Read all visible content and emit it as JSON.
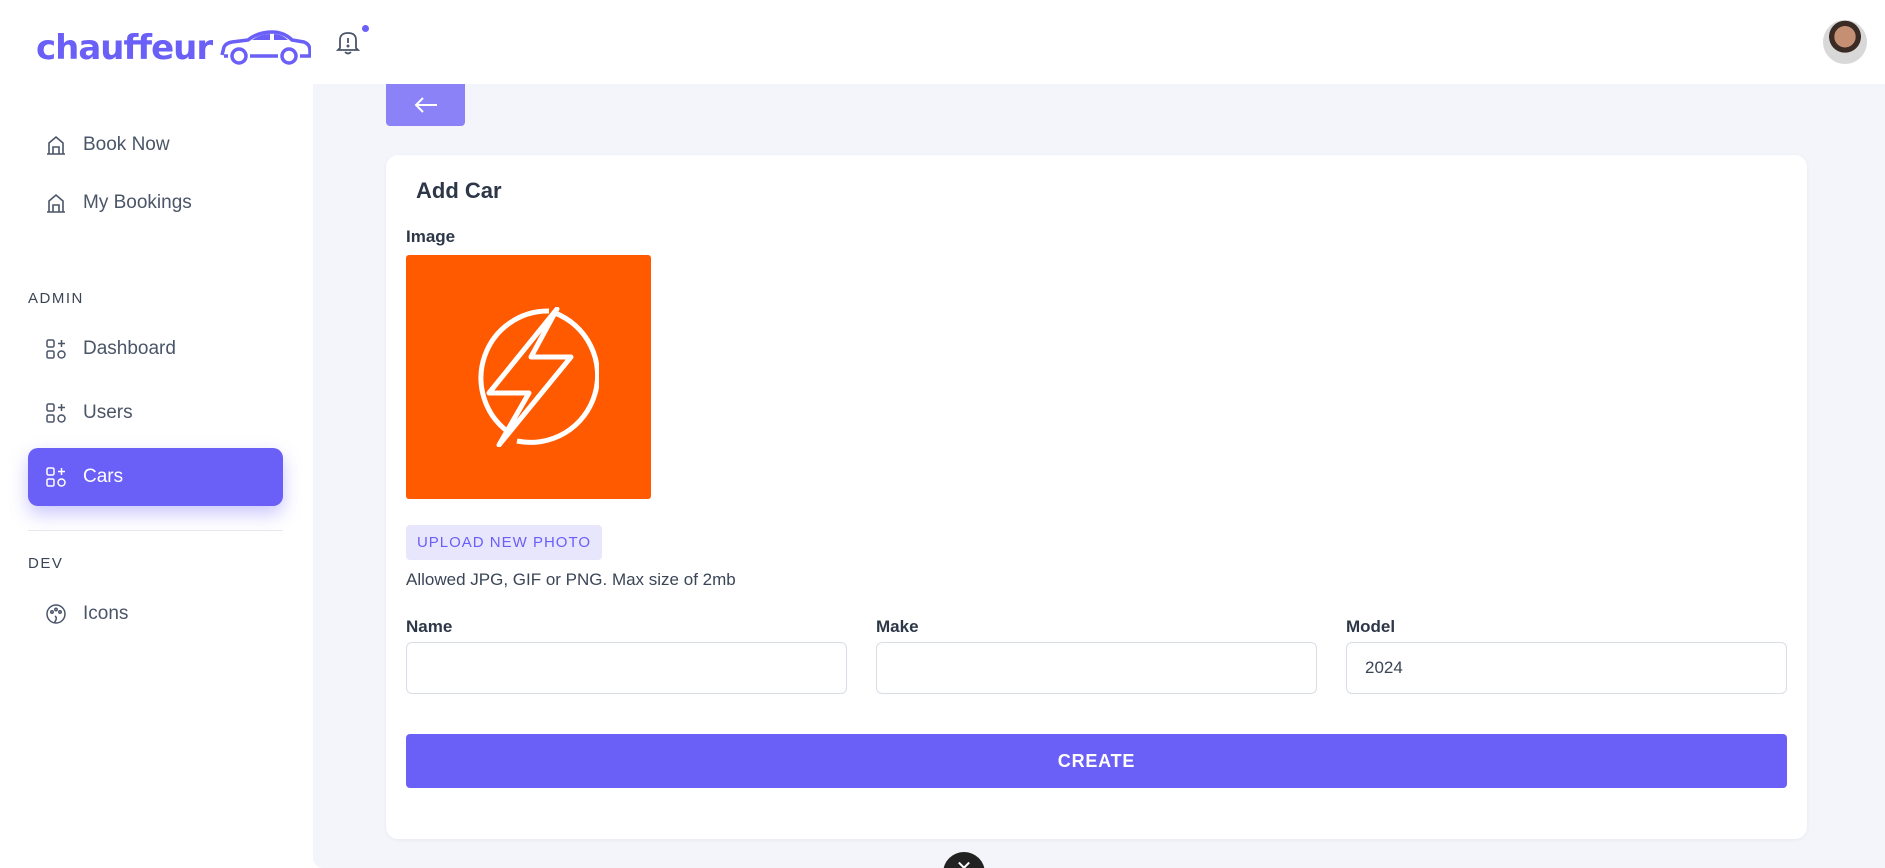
{
  "brand": {
    "name": "chauffeur",
    "accent": "#6a5ff6"
  },
  "sidebar": {
    "top_items": [
      {
        "label": "Book Now",
        "icon": "home-icon"
      },
      {
        "label": "My Bookings",
        "icon": "home-icon"
      }
    ],
    "admin_section": "ADMIN",
    "admin_items": [
      {
        "label": "Dashboard",
        "icon": "grid-plus-icon"
      },
      {
        "label": "Users",
        "icon": "grid-plus-icon"
      },
      {
        "label": "Cars",
        "icon": "grid-plus-icon",
        "active": true
      }
    ],
    "dev_section": "DEV",
    "dev_items": [
      {
        "label": "Icons",
        "icon": "palette-icon"
      }
    ]
  },
  "header": {
    "notification_icon": "bell-icon",
    "has_unread": true
  },
  "form": {
    "title": "Add Car",
    "image_label": "Image",
    "upload_label": "UPLOAD NEW PHOTO",
    "upload_hint": "Allowed JPG, GIF or PNG. Max size of 2mb",
    "name_label": "Name",
    "name_value": "",
    "make_label": "Make",
    "make_value": "",
    "model_label": "Model",
    "model_value": "2024",
    "submit_label": "CREATE"
  },
  "colors": {
    "preview_bg": "#ff5a00",
    "page_bg": "#f3f5fa"
  }
}
